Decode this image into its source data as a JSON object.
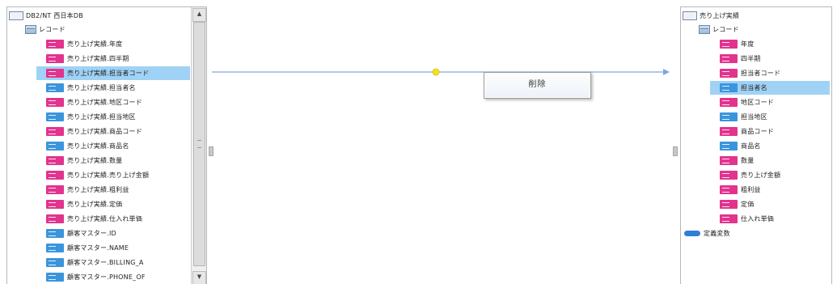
{
  "source_tree": {
    "root_label": "DB2/NT 西日本DB",
    "record_label": "レコード",
    "fields": [
      {
        "label": "売り上げ実績.年度",
        "type": "str",
        "selected": false
      },
      {
        "label": "売り上げ実績.四半期",
        "type": "str",
        "selected": false
      },
      {
        "label": "売り上げ実績.担当者コード",
        "type": "str",
        "selected": true
      },
      {
        "label": "売り上げ実績.担当者名",
        "type": "num",
        "selected": false
      },
      {
        "label": "売り上げ実績.地区コード",
        "type": "str",
        "selected": false
      },
      {
        "label": "売り上げ実績.担当地区",
        "type": "num",
        "selected": false
      },
      {
        "label": "売り上げ実績.商品コード",
        "type": "str",
        "selected": false
      },
      {
        "label": "売り上げ実績.商品名",
        "type": "num",
        "selected": false
      },
      {
        "label": "売り上げ実績.数量",
        "type": "str",
        "selected": false
      },
      {
        "label": "売り上げ実績.売り上げ金額",
        "type": "str",
        "selected": false
      },
      {
        "label": "売り上げ実績.粗利益",
        "type": "str",
        "selected": false
      },
      {
        "label": "売り上げ実績.定価",
        "type": "str",
        "selected": false
      },
      {
        "label": "売り上げ実績.仕入れ単価",
        "type": "str",
        "selected": false
      },
      {
        "label": "顧客マスター.ID",
        "type": "num",
        "selected": false
      },
      {
        "label": "顧客マスター.NAME",
        "type": "num",
        "selected": false
      },
      {
        "label": "顧客マスター.BILLING_A",
        "type": "num",
        "selected": false
      },
      {
        "label": "顧客マスター.PHONE_OF",
        "type": "num",
        "selected": false
      }
    ]
  },
  "target_tree": {
    "root_label": "売り上げ実績",
    "record_label": "レコード",
    "fields": [
      {
        "label": "年度",
        "type": "str",
        "selected": false
      },
      {
        "label": "四半期",
        "type": "str",
        "selected": false
      },
      {
        "label": "担当者コード",
        "type": "str",
        "selected": false
      },
      {
        "label": "担当者名",
        "type": "num",
        "selected": true
      },
      {
        "label": "地区コード",
        "type": "str",
        "selected": false
      },
      {
        "label": "担当地区",
        "type": "num",
        "selected": false
      },
      {
        "label": "商品コード",
        "type": "str",
        "selected": false
      },
      {
        "label": "商品名",
        "type": "num",
        "selected": false
      },
      {
        "label": "数量",
        "type": "str",
        "selected": false
      },
      {
        "label": "売り上げ金額",
        "type": "str",
        "selected": false
      },
      {
        "label": "粗利益",
        "type": "str",
        "selected": false
      },
      {
        "label": "定価",
        "type": "str",
        "selected": false
      },
      {
        "label": "仕入れ単価",
        "type": "str",
        "selected": false
      }
    ],
    "definition_label": "定義変数"
  },
  "context_menu": {
    "delete_label": "削除"
  },
  "scrollbar": {
    "up_arrow": "▲",
    "down_arrow": "▼"
  },
  "colors": {
    "selection": "#9fd2f5",
    "string_chip": "#e2338e",
    "number_chip": "#3a95dd",
    "mapping_line": "#7fa8d9",
    "link_handle": "#f2e21a"
  }
}
